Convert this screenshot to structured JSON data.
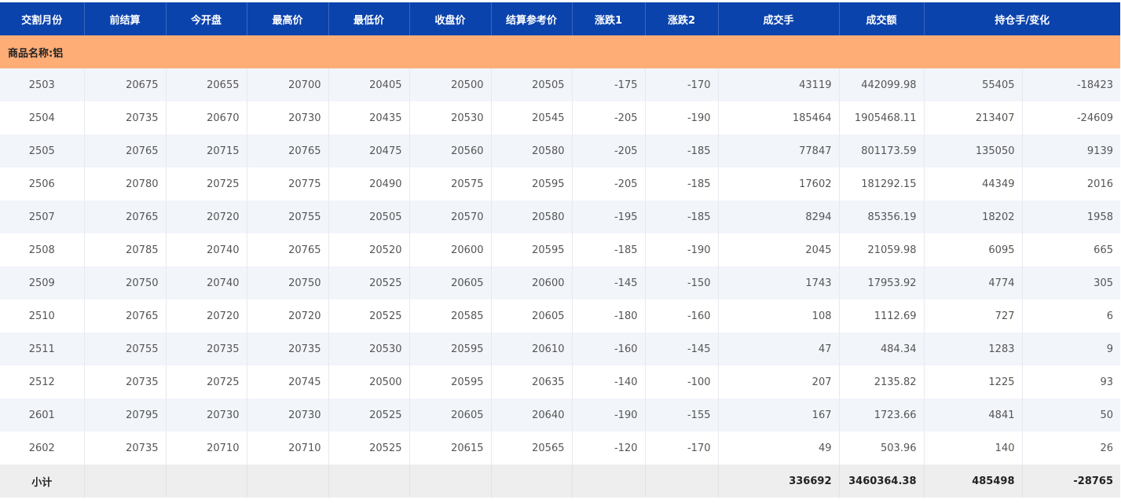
{
  "headers": [
    "交割月份",
    "前结算",
    "今开盘",
    "最高价",
    "最低价",
    "收盘价",
    "结算参考价",
    "涨跌1",
    "涨跌2",
    "成交手",
    "成交额",
    "持仓手/变化"
  ],
  "category": "商品名称:铝",
  "rows": [
    [
      "2503",
      "20675",
      "20655",
      "20700",
      "20405",
      "20500",
      "20505",
      "-175",
      "-170",
      "43119",
      "442099.98",
      "55405",
      "-18423"
    ],
    [
      "2504",
      "20735",
      "20670",
      "20730",
      "20435",
      "20530",
      "20545",
      "-205",
      "-190",
      "185464",
      "1905468.11",
      "213407",
      "-24609"
    ],
    [
      "2505",
      "20765",
      "20715",
      "20765",
      "20475",
      "20560",
      "20580",
      "-205",
      "-185",
      "77847",
      "801173.59",
      "135050",
      "9139"
    ],
    [
      "2506",
      "20780",
      "20725",
      "20775",
      "20490",
      "20575",
      "20595",
      "-205",
      "-185",
      "17602",
      "181292.15",
      "44349",
      "2016"
    ],
    [
      "2507",
      "20765",
      "20720",
      "20755",
      "20505",
      "20570",
      "20580",
      "-195",
      "-185",
      "8294",
      "85356.19",
      "18202",
      "1958"
    ],
    [
      "2508",
      "20785",
      "20740",
      "20765",
      "20520",
      "20600",
      "20595",
      "-185",
      "-190",
      "2045",
      "21059.98",
      "6095",
      "665"
    ],
    [
      "2509",
      "20750",
      "20740",
      "20750",
      "20525",
      "20605",
      "20600",
      "-145",
      "-150",
      "1743",
      "17953.92",
      "4774",
      "305"
    ],
    [
      "2510",
      "20765",
      "20720",
      "20720",
      "20525",
      "20585",
      "20605",
      "-180",
      "-160",
      "108",
      "1112.69",
      "727",
      "6"
    ],
    [
      "2511",
      "20755",
      "20735",
      "20735",
      "20530",
      "20595",
      "20610",
      "-160",
      "-145",
      "47",
      "484.34",
      "1283",
      "9"
    ],
    [
      "2512",
      "20735",
      "20725",
      "20745",
      "20500",
      "20595",
      "20635",
      "-140",
      "-100",
      "207",
      "2135.82",
      "1225",
      "93"
    ],
    [
      "2601",
      "20795",
      "20730",
      "20730",
      "20525",
      "20605",
      "20640",
      "-190",
      "-155",
      "167",
      "1723.66",
      "4841",
      "50"
    ],
    [
      "2602",
      "20735",
      "20710",
      "20710",
      "20525",
      "20615",
      "20565",
      "-120",
      "-170",
      "49",
      "503.96",
      "140",
      "26"
    ]
  ],
  "total": {
    "label": "小计",
    "volume": "336692",
    "turnover": "3460364.38",
    "open_interest": "485498",
    "oi_change": "-28765"
  }
}
